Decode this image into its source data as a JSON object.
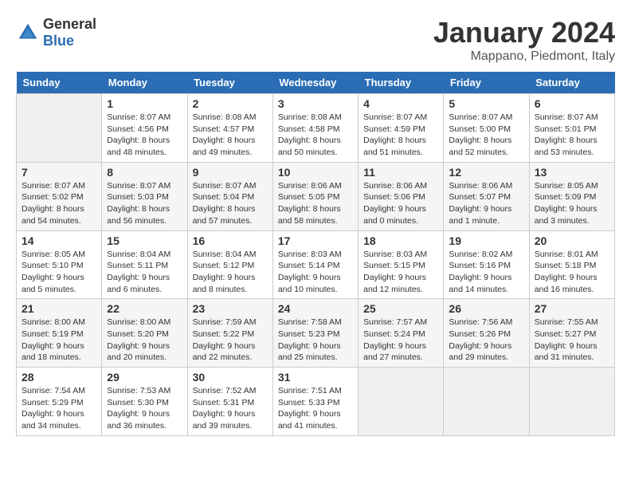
{
  "header": {
    "logo_general": "General",
    "logo_blue": "Blue",
    "month_title": "January 2024",
    "location": "Mappano, Piedmont, Italy"
  },
  "weekdays": [
    "Sunday",
    "Monday",
    "Tuesday",
    "Wednesday",
    "Thursday",
    "Friday",
    "Saturday"
  ],
  "weeks": [
    [
      {
        "day": "",
        "info": ""
      },
      {
        "day": "1",
        "info": "Sunrise: 8:07 AM\nSunset: 4:56 PM\nDaylight: 8 hours\nand 48 minutes."
      },
      {
        "day": "2",
        "info": "Sunrise: 8:08 AM\nSunset: 4:57 PM\nDaylight: 8 hours\nand 49 minutes."
      },
      {
        "day": "3",
        "info": "Sunrise: 8:08 AM\nSunset: 4:58 PM\nDaylight: 8 hours\nand 50 minutes."
      },
      {
        "day": "4",
        "info": "Sunrise: 8:07 AM\nSunset: 4:59 PM\nDaylight: 8 hours\nand 51 minutes."
      },
      {
        "day": "5",
        "info": "Sunrise: 8:07 AM\nSunset: 5:00 PM\nDaylight: 8 hours\nand 52 minutes."
      },
      {
        "day": "6",
        "info": "Sunrise: 8:07 AM\nSunset: 5:01 PM\nDaylight: 8 hours\nand 53 minutes."
      }
    ],
    [
      {
        "day": "7",
        "info": "Sunrise: 8:07 AM\nSunset: 5:02 PM\nDaylight: 8 hours\nand 54 minutes."
      },
      {
        "day": "8",
        "info": "Sunrise: 8:07 AM\nSunset: 5:03 PM\nDaylight: 8 hours\nand 56 minutes."
      },
      {
        "day": "9",
        "info": "Sunrise: 8:07 AM\nSunset: 5:04 PM\nDaylight: 8 hours\nand 57 minutes."
      },
      {
        "day": "10",
        "info": "Sunrise: 8:06 AM\nSunset: 5:05 PM\nDaylight: 8 hours\nand 58 minutes."
      },
      {
        "day": "11",
        "info": "Sunrise: 8:06 AM\nSunset: 5:06 PM\nDaylight: 9 hours\nand 0 minutes."
      },
      {
        "day": "12",
        "info": "Sunrise: 8:06 AM\nSunset: 5:07 PM\nDaylight: 9 hours\nand 1 minute."
      },
      {
        "day": "13",
        "info": "Sunrise: 8:05 AM\nSunset: 5:09 PM\nDaylight: 9 hours\nand 3 minutes."
      }
    ],
    [
      {
        "day": "14",
        "info": "Sunrise: 8:05 AM\nSunset: 5:10 PM\nDaylight: 9 hours\nand 5 minutes."
      },
      {
        "day": "15",
        "info": "Sunrise: 8:04 AM\nSunset: 5:11 PM\nDaylight: 9 hours\nand 6 minutes."
      },
      {
        "day": "16",
        "info": "Sunrise: 8:04 AM\nSunset: 5:12 PM\nDaylight: 9 hours\nand 8 minutes."
      },
      {
        "day": "17",
        "info": "Sunrise: 8:03 AM\nSunset: 5:14 PM\nDaylight: 9 hours\nand 10 minutes."
      },
      {
        "day": "18",
        "info": "Sunrise: 8:03 AM\nSunset: 5:15 PM\nDaylight: 9 hours\nand 12 minutes."
      },
      {
        "day": "19",
        "info": "Sunrise: 8:02 AM\nSunset: 5:16 PM\nDaylight: 9 hours\nand 14 minutes."
      },
      {
        "day": "20",
        "info": "Sunrise: 8:01 AM\nSunset: 5:18 PM\nDaylight: 9 hours\nand 16 minutes."
      }
    ],
    [
      {
        "day": "21",
        "info": "Sunrise: 8:00 AM\nSunset: 5:19 PM\nDaylight: 9 hours\nand 18 minutes."
      },
      {
        "day": "22",
        "info": "Sunrise: 8:00 AM\nSunset: 5:20 PM\nDaylight: 9 hours\nand 20 minutes."
      },
      {
        "day": "23",
        "info": "Sunrise: 7:59 AM\nSunset: 5:22 PM\nDaylight: 9 hours\nand 22 minutes."
      },
      {
        "day": "24",
        "info": "Sunrise: 7:58 AM\nSunset: 5:23 PM\nDaylight: 9 hours\nand 25 minutes."
      },
      {
        "day": "25",
        "info": "Sunrise: 7:57 AM\nSunset: 5:24 PM\nDaylight: 9 hours\nand 27 minutes."
      },
      {
        "day": "26",
        "info": "Sunrise: 7:56 AM\nSunset: 5:26 PM\nDaylight: 9 hours\nand 29 minutes."
      },
      {
        "day": "27",
        "info": "Sunrise: 7:55 AM\nSunset: 5:27 PM\nDaylight: 9 hours\nand 31 minutes."
      }
    ],
    [
      {
        "day": "28",
        "info": "Sunrise: 7:54 AM\nSunset: 5:29 PM\nDaylight: 9 hours\nand 34 minutes."
      },
      {
        "day": "29",
        "info": "Sunrise: 7:53 AM\nSunset: 5:30 PM\nDaylight: 9 hours\nand 36 minutes."
      },
      {
        "day": "30",
        "info": "Sunrise: 7:52 AM\nSunset: 5:31 PM\nDaylight: 9 hours\nand 39 minutes."
      },
      {
        "day": "31",
        "info": "Sunrise: 7:51 AM\nSunset: 5:33 PM\nDaylight: 9 hours\nand 41 minutes."
      },
      {
        "day": "",
        "info": ""
      },
      {
        "day": "",
        "info": ""
      },
      {
        "day": "",
        "info": ""
      }
    ]
  ]
}
